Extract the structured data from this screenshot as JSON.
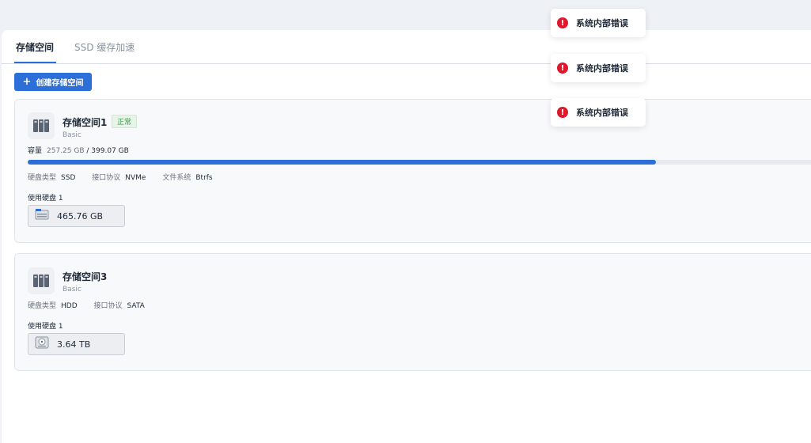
{
  "tabs": [
    {
      "label": "存储空间",
      "active": true
    },
    {
      "label": "SSD 缓存加速",
      "active": false
    }
  ],
  "create_button": {
    "label": "创建存储空间",
    "icon": "plus-icon"
  },
  "pools": [
    {
      "name": "存储空间1",
      "type": "Basic",
      "status": "正常",
      "capacity": {
        "label": "容量",
        "used": "257.25 GB",
        "total": "/ 399.07 GB",
        "fill_fraction": 0.8
      },
      "meta": [
        {
          "key": "硬盘类型",
          "value": "SSD"
        },
        {
          "key": "接口协议",
          "value": "NVMe"
        },
        {
          "key": "文件系统",
          "value": "Btrfs"
        }
      ],
      "disks_label": "使用硬盘 1",
      "disks": [
        {
          "size": "465.76 GB",
          "icon": "nvme-ssd-icon"
        }
      ]
    },
    {
      "name": "存储空间3",
      "type": "Basic",
      "meta": [
        {
          "key": "硬盘类型",
          "value": "HDD"
        },
        {
          "key": "接口协议",
          "value": "SATA"
        }
      ],
      "disks_label": "使用硬盘 1",
      "disks": [
        {
          "size": "3.64 TB",
          "icon": "hdd-icon"
        }
      ]
    }
  ],
  "toasts": [
    {
      "message": "系统内部错误"
    },
    {
      "message": "系统内部错误"
    },
    {
      "message": "系统内部错误"
    }
  ],
  "colors": {
    "accent": "#2c6fd9",
    "error": "#e0182d",
    "ok": "#3b9b45"
  }
}
